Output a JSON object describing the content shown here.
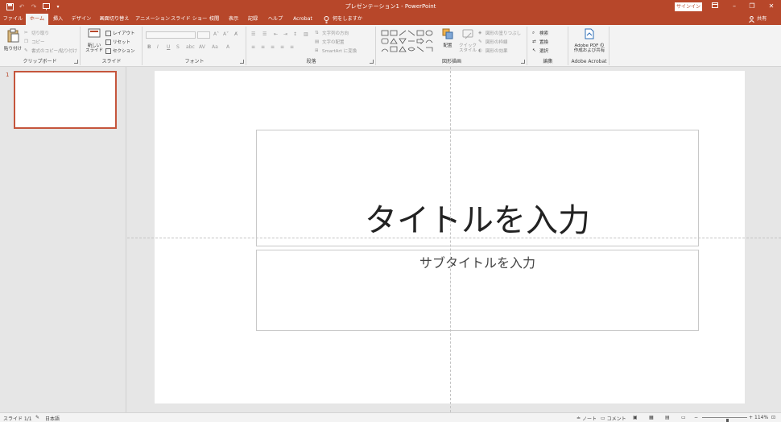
{
  "window": {
    "title": "プレゼンテーション1  -  PowerPoint",
    "signin_label": "サインイン"
  },
  "tabs": [
    {
      "label": "ファイル",
      "active": false
    },
    {
      "label": "ホーム",
      "active": true
    },
    {
      "label": "挿入",
      "active": false
    },
    {
      "label": "デザイン",
      "active": false
    },
    {
      "label": "画面切り替え",
      "active": false
    },
    {
      "label": "アニメーション",
      "active": false
    },
    {
      "label": "スライド ショー",
      "active": false
    },
    {
      "label": "校閲",
      "active": false
    },
    {
      "label": "表示",
      "active": false
    },
    {
      "label": "記録",
      "active": false
    },
    {
      "label": "ヘルプ",
      "active": false
    },
    {
      "label": "Acrobat",
      "active": false
    }
  ],
  "tell_me": "何をしますか",
  "share_label": "共有",
  "ribbon": {
    "clipboard": {
      "label": "クリップボード",
      "paste": "貼り付け",
      "cut": "切り取り",
      "copy": "コピー",
      "format_painter": "書式のコピー/貼り付け"
    },
    "slides": {
      "label": "スライド",
      "new_slide_1": "新しい",
      "new_slide_2": "スライド",
      "layout": "レイアウト",
      "reset": "リセット",
      "section": "セクション"
    },
    "font": {
      "label": "フォント"
    },
    "paragraph": {
      "label": "段落",
      "text_direction": "文字列の方向",
      "align_text": "文字の配置",
      "smartart": "SmartArt に変換"
    },
    "drawing": {
      "label": "図形描画",
      "arrange": "配置",
      "quick_styles_1": "クイック",
      "quick_styles_2": "スタイル",
      "shape_fill": "図形の塗りつぶし",
      "shape_outline": "図形の枠線",
      "shape_effects": "図形の効果"
    },
    "editing": {
      "label": "編集",
      "find": "検索",
      "replace": "置換",
      "select": "選択"
    },
    "acrobat": {
      "label": "Adobe Acrobat",
      "create_pdf_1": "Adobe PDF の",
      "create_pdf_2": "作成および共有"
    }
  },
  "thumbnails": [
    {
      "number": "1"
    }
  ],
  "slide": {
    "title_placeholder": "タイトルを入力",
    "subtitle_placeholder": "サブタイトルを入力"
  },
  "status": {
    "slide_indicator": "スライド 1/1",
    "language": "日本語",
    "notes": "ノート",
    "comments": "コメント",
    "zoom": "114%",
    "zoom_fraction": 0.56
  },
  "colors": {
    "accent": "#b7472a",
    "selection": "#c5553c"
  }
}
